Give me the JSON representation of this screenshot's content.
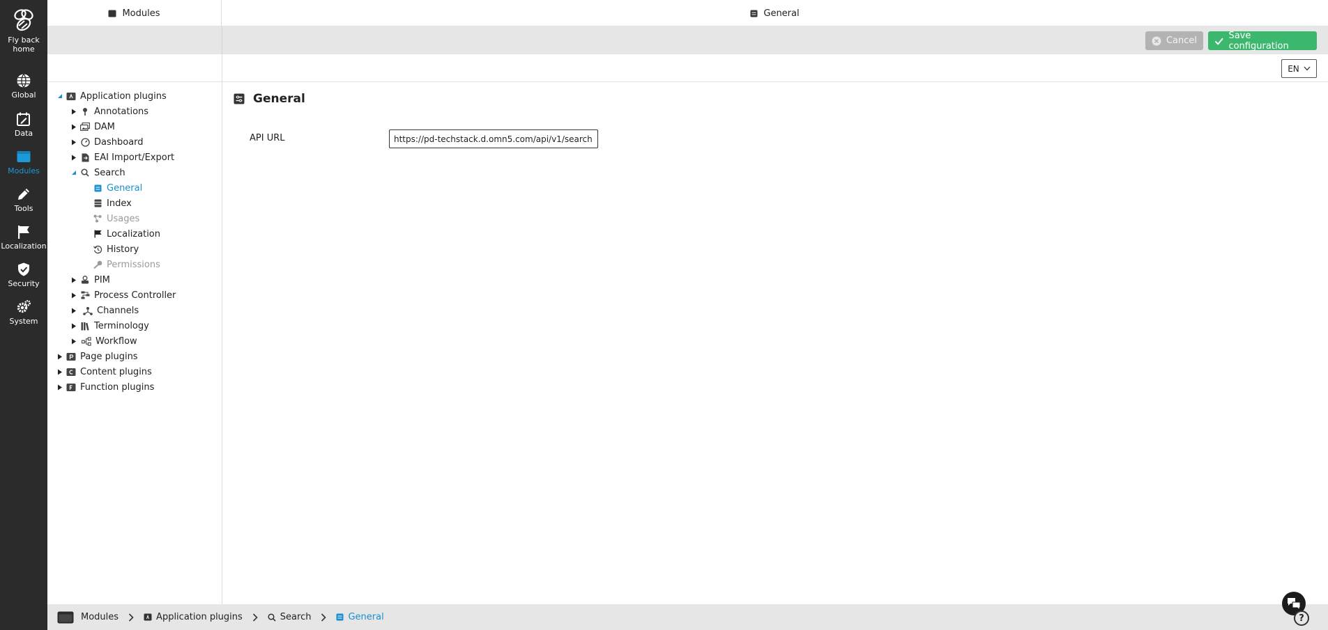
{
  "leftnav": {
    "items": [
      {
        "label": "Fly back home",
        "icon": "bee-icon",
        "active": false
      },
      {
        "label": "Global",
        "icon": "globe-icon",
        "active": false
      },
      {
        "label": "Data",
        "icon": "calendar-edit-icon",
        "active": false
      },
      {
        "label": "Modules",
        "icon": "window-icon",
        "active": true
      },
      {
        "label": "Tools",
        "icon": "pencil-icon",
        "active": false
      },
      {
        "label": "Localization",
        "icon": "flag-icon",
        "active": false
      },
      {
        "label": "Security",
        "icon": "shield-check-icon",
        "active": false
      },
      {
        "label": "System",
        "icon": "gears-icon",
        "active": false
      }
    ]
  },
  "header": {
    "left_title": "Modules",
    "main_title": "General"
  },
  "toolbar": {
    "cancel_label": "Cancel",
    "save_label": "Save configuration"
  },
  "language": {
    "selected": "EN"
  },
  "tree": {
    "items": [
      {
        "label": "Application plugins",
        "level": 0,
        "state": "expanded",
        "icon": "plugin-folder-icon"
      },
      {
        "label": "Annotations",
        "level": 1,
        "state": "collapsed",
        "icon": "pin-icon"
      },
      {
        "label": "DAM",
        "level": 1,
        "state": "collapsed",
        "icon": "images-icon"
      },
      {
        "label": "Dashboard",
        "level": 1,
        "state": "collapsed",
        "icon": "gauge-icon"
      },
      {
        "label": "EAI Import/Export",
        "level": 1,
        "state": "collapsed",
        "icon": "file-transfer-icon"
      },
      {
        "label": "Search",
        "level": 1,
        "state": "expanded",
        "icon": "search-icon"
      },
      {
        "label": "General",
        "level": 2,
        "state": "selected",
        "icon": "settings-list-icon"
      },
      {
        "label": "Index",
        "level": 2,
        "state": "normal",
        "icon": "database-icon"
      },
      {
        "label": "Usages",
        "level": 2,
        "state": "disabled",
        "icon": "share-nodes-icon"
      },
      {
        "label": "Localization",
        "level": 2,
        "state": "normal",
        "icon": "flag-icon"
      },
      {
        "label": "History",
        "level": 2,
        "state": "normal",
        "icon": "history-icon"
      },
      {
        "label": "Permissions",
        "level": 2,
        "state": "disabled",
        "icon": "key-icon"
      },
      {
        "label": "PIM",
        "level": 1,
        "state": "collapsed",
        "icon": "boxes-icon"
      },
      {
        "label": "Process Controller",
        "level": 1,
        "state": "collapsed",
        "icon": "process-icon"
      },
      {
        "label": "Channels",
        "level": 1,
        "state": "collapsed",
        "icon": "channels-icon"
      },
      {
        "label": "Terminology",
        "level": 1,
        "state": "collapsed",
        "icon": "books-icon"
      },
      {
        "label": "Workflow",
        "level": 1,
        "state": "collapsed",
        "icon": "workflow-icon"
      },
      {
        "label": "Page plugins",
        "level": 0,
        "state": "collapsed",
        "icon": "plugin-folder-icon"
      },
      {
        "label": "Content plugins",
        "level": 0,
        "state": "collapsed",
        "icon": "plugin-folder-icon"
      },
      {
        "label": "Function plugins",
        "level": 0,
        "state": "collapsed",
        "icon": "plugin-folder-icon"
      }
    ]
  },
  "main": {
    "section_title": "General",
    "fields": [
      {
        "label": "API URL",
        "value": "https://pd-techstack.d.omn5.com/api/v1/search"
      }
    ]
  },
  "breadcrumb": [
    {
      "label": "Modules",
      "icon": "window-icon"
    },
    {
      "label": "Application plugins",
      "icon": "plugin-folder-icon"
    },
    {
      "label": "Search",
      "icon": "search-icon"
    },
    {
      "label": "General",
      "icon": "settings-list-icon"
    }
  ],
  "help": {
    "label": "?"
  },
  "colors": {
    "accent": "#1a8fd0",
    "nav_bg": "#2b2b2b",
    "save": "#3cb86e",
    "cancel": "#b3b3b3"
  }
}
